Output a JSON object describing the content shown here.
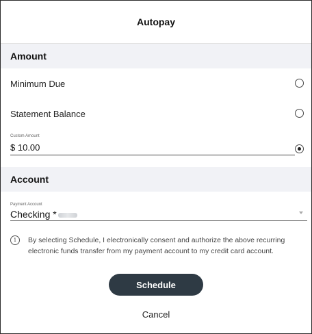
{
  "header": {
    "title": "Autopay"
  },
  "amount": {
    "section_title": "Amount",
    "options": [
      {
        "label": "Minimum Due",
        "selected": false
      },
      {
        "label": "Statement Balance",
        "selected": false
      }
    ],
    "custom": {
      "field_label": "Custom Amount",
      "currency": "$",
      "value": "10.00",
      "selected": true
    }
  },
  "account": {
    "section_title": "Account",
    "field_label": "Payment Account",
    "value": "Checking *"
  },
  "notice": {
    "icon": "info-icon",
    "text": "By selecting Schedule, I electronically consent and authorize the above recurring electronic funds transfer from my payment account to my credit card account."
  },
  "actions": {
    "schedule_label": "Schedule",
    "cancel_label": "Cancel"
  },
  "colors": {
    "primary_button": "#2e3a44",
    "section_background": "#f1f2f6"
  }
}
